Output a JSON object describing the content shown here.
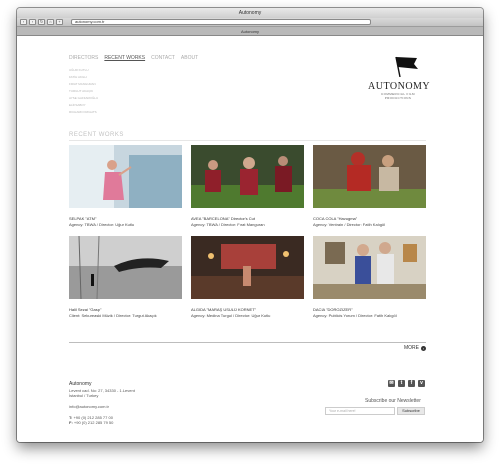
{
  "window": {
    "title": "Autonomy",
    "tab_title": "Autonomy",
    "url": "autonomy.com.tr"
  },
  "nav": [
    {
      "label": "DIRECTORS",
      "active": false
    },
    {
      "label": "RECENT WORKS",
      "active": true
    },
    {
      "label": "CONTACT",
      "active": false
    },
    {
      "label": "ABOUT",
      "active": false
    }
  ],
  "subnav": [
    "UĞUR KUTLU",
    "FATİH AKILLI",
    "FIRAT MANGURAN",
    "TURGUT AKAÇIK",
    "AYSE GAFFAROĞLU",
    "ELİFSABOY",
    "RICHARD FRIGHTS"
  ],
  "logo": {
    "text": "AUTONOMY",
    "subtitle": "COMMERCIAL FILM PRODUCTIONS"
  },
  "section_title": "RECENT WORKS",
  "works": [
    {
      "title": "SELPAK \"ATM\"",
      "agency": "Agency: TBWA / Director: Uğur Kutlu"
    },
    {
      "title": "AVEA \"BARCELONA\" Director's Cut",
      "agency": "Agency: TBWA / Director: Fırat Manguran"
    },
    {
      "title": "COCA COLA \"Havugma\"",
      "agency": "Agency: Ventrain / Director: Fatih Kalıgöl"
    },
    {
      "title": "Halil Sezai \"Gasp\"",
      "agency": "Client: Sekureaski Müzik / Director: Turgut Akaçık"
    },
    {
      "title": "ALGIDA \"MARAŞ USULÜ KORNET\"",
      "agency": "Agency: Medina Turgul / Director: Uğur Kutlu"
    },
    {
      "title": "DACIA \"DOROZIZER\"",
      "agency": "Agency: Publicis Yorum / Director: Fatih Kalıgöl"
    }
  ],
  "more_label": "MORE",
  "footer": {
    "company": "Autonomy",
    "address_1": "Levent cad. No: 27, 34330 - 1.Levent",
    "address_2": "İstanbul / Turkey",
    "email": "info@autonomy.com.tr",
    "phone_label": "T:",
    "phone": "+90 (0) 212 285 77 00",
    "fax_label": "F:",
    "fax": "+90 (0) 212 285 79 50",
    "newsletter_label": "Subscribe our Newsletter",
    "email_placeholder": "Your e-mail here!",
    "subscribe_label": "Subscribe"
  },
  "colors": {
    "accent": "#333333",
    "muted": "#aaaaaa"
  },
  "social_icons": [
    "mail-icon",
    "twitter-icon",
    "facebook-icon",
    "vimeo-icon"
  ]
}
